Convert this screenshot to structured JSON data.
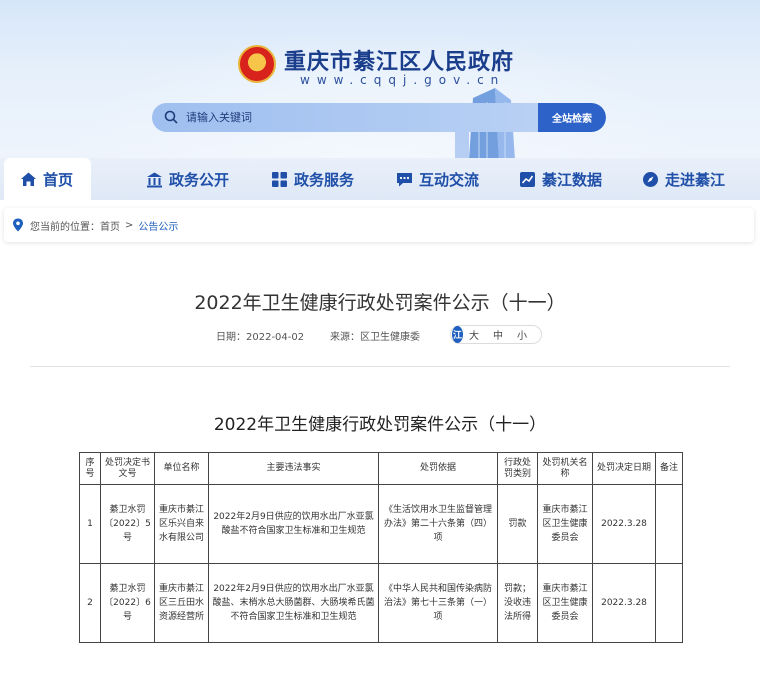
{
  "site": {
    "title": "重庆市綦江区人民政府",
    "url": "www.cqqj.gov.cn"
  },
  "search": {
    "placeholder": "请输入关键词",
    "button_label": "全站检索"
  },
  "nav": {
    "items": [
      {
        "label": "首页",
        "icon": "home-icon",
        "active": true
      },
      {
        "label": "政务公开",
        "icon": "building-icon"
      },
      {
        "label": "政务服务",
        "icon": "grid-icon"
      },
      {
        "label": "互动交流",
        "icon": "chat-icon"
      },
      {
        "label": "綦江数据",
        "icon": "chart-icon"
      },
      {
        "label": "走进綦江",
        "icon": "compass-icon"
      }
    ]
  },
  "breadcrumb": {
    "prefix": "您当前的位置：",
    "home": "首页",
    "separator": ">",
    "current": "公告公示"
  },
  "article": {
    "title": "2022年卫生健康行政处罚案件公示（十一）",
    "date": "日期：2022-04-02",
    "source": "来源：区卫生健康委",
    "font_logo": "江",
    "font_sizes": [
      "大",
      "中",
      "小"
    ]
  },
  "table": {
    "title": "2022年卫生健康行政处罚案件公示（十一）",
    "headers": [
      "序号",
      "处罚决定书文号",
      "单位名称",
      "主要违法事实",
      "处罚依据",
      "行政处罚类别",
      "处罚机关名称",
      "处罚决定日期",
      "备注"
    ],
    "rows": [
      [
        "1",
        "綦卫水罚〔2022〕5号",
        "重庆市綦江区乐兴自来水有限公司",
        "2022年2月9日供应的饮用水出厂水亚氯酸盐不符合国家卫生标准和卫生规范",
        "《生活饮用水卫生监督管理办法》第二十六条第（四）项",
        "罚款",
        "重庆市綦江区卫生健康委员会",
        "2022.3.28",
        ""
      ],
      [
        "2",
        "綦卫水罚〔2022〕6号",
        "重庆市綦江区三丘田水资源经营所",
        "2022年2月9日供应的饮用水出厂水亚氯酸盐、末梢水总大肠菌群、大肠埃希氏菌不符合国家卫生标准和卫生规范",
        "《中华人民共和国传染病防治法》第七十三条第（一）项",
        "罚款；没收违法所得",
        "重庆市綦江区卫生健康委员会",
        "2022.3.28",
        ""
      ]
    ]
  },
  "colors": {
    "brand_blue": "#1f4fa8",
    "search_button": "#2d63c8"
  }
}
